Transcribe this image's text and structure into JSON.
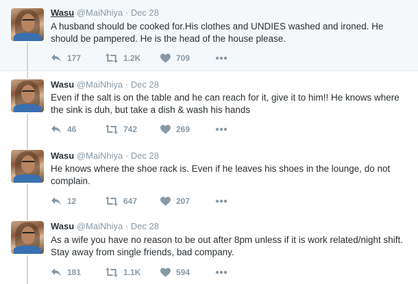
{
  "tweets": [
    {
      "name": "Wasu",
      "handle": "@MaiNhiya",
      "separator": "·",
      "date": "Dec 28",
      "text": "A husband should be cooked for.His clothes and UNDIES washed and ironed. He should be pampered. He is the head of the house please.",
      "replies": "177",
      "retweets": "1.2K",
      "likes": "709"
    },
    {
      "name": "Wasu",
      "handle": "@MaiNhiya",
      "separator": "·",
      "date": "Dec 28",
      "text": "Even if the salt is on the table and he can reach for it, give it to him!! He knows where the sink is duh, but take a dish & wash his hands",
      "replies": "46",
      "retweets": "742",
      "likes": "269"
    },
    {
      "name": "Wasu",
      "handle": "@MaiNhiya",
      "separator": "·",
      "date": "Dec 28",
      "text": "He knows where the shoe rack is. Even if he leaves his shoes in the lounge, do not complain.",
      "replies": "12",
      "retweets": "647",
      "likes": "207"
    },
    {
      "name": "Wasu",
      "handle": "@MaiNhiya",
      "separator": "·",
      "date": "Dec 28",
      "text": "As a wife you have no reason to be out after 8pm unless if it is work related/night shift. Stay away from single friends, bad company.",
      "replies": "181",
      "retweets": "1.1K",
      "likes": "594"
    }
  ],
  "icons": {
    "reply": "reply-icon",
    "retweet": "retweet-icon",
    "like": "heart-icon",
    "more": "more-icon"
  },
  "colors": {
    "text": "#292f33",
    "muted": "#8899a6",
    "thread_line": "#ccd6dd",
    "highlight_background": "#f5f8fa"
  }
}
